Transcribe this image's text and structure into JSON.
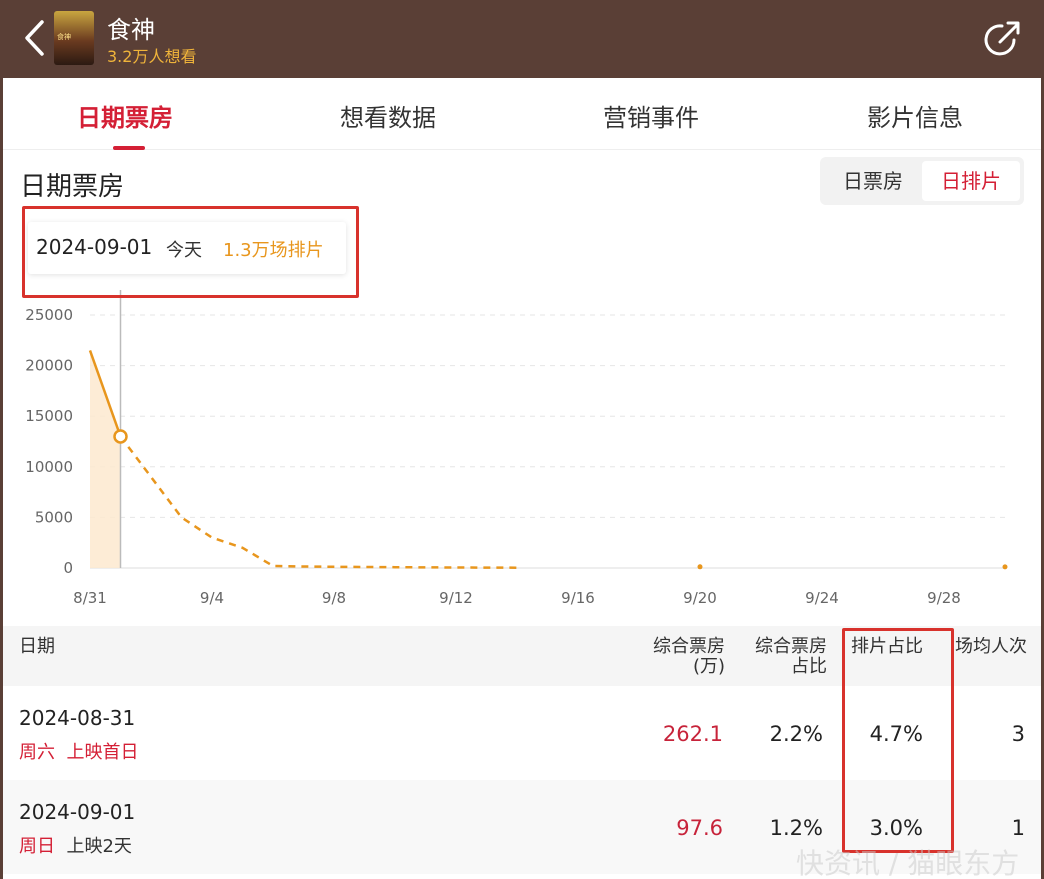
{
  "header": {
    "title": "食神",
    "want_count": "3.2万人想看",
    "poster_lettering": "食神"
  },
  "tabs": [
    {
      "label": "日期票房",
      "active": true
    },
    {
      "label": "想看数据",
      "active": false
    },
    {
      "label": "营销事件",
      "active": false
    },
    {
      "label": "影片信息",
      "active": false
    }
  ],
  "section": {
    "title": "日期票房",
    "toggle": [
      {
        "label": "日票房",
        "active": false
      },
      {
        "label": "日排片",
        "active": true
      }
    ]
  },
  "tooltip": {
    "date": "2024-09-01",
    "day": "今天",
    "value": "1.3万场排片"
  },
  "chart_data": {
    "type": "line",
    "x": [
      "8/31",
      "9/1",
      "9/2",
      "9/3",
      "9/4",
      "9/5",
      "9/6",
      "9/7",
      "9/8",
      "9/9",
      "9/10",
      "9/11",
      "9/12",
      "9/13",
      "9/14",
      "9/20",
      "9/30"
    ],
    "values": [
      21500,
      13000,
      9000,
      5000,
      3000,
      2000,
      200,
      150,
      120,
      100,
      80,
      60,
      50,
      40,
      30,
      20,
      10
    ],
    "tick_labels_x": [
      "8/31",
      "9/4",
      "9/8",
      "9/12",
      "9/16",
      "9/20",
      "9/24",
      "9/28"
    ],
    "tick_labels_y": [
      "0",
      "5000",
      "10000",
      "15000",
      "20000",
      "25000"
    ],
    "ylim": [
      0,
      25000
    ],
    "grid": true,
    "highlight_x": "9/1",
    "colors": {
      "line": "#e8961d",
      "area": "#fde9cf",
      "cursor": "#bbbbbb"
    }
  },
  "table": {
    "headers": {
      "date": "日期",
      "box_office": [
        "综合票房",
        "(万)"
      ],
      "box_share": [
        "综合票房",
        "占比"
      ],
      "screening_share": "排片占比",
      "avg_attendance": "场均人次"
    },
    "rows": [
      {
        "date": "2024-08-31",
        "weekday": "周六",
        "tag": "上映首日",
        "tag_color": "red",
        "box_office": "262.1",
        "box_share": "2.2%",
        "screening_share": "4.7%",
        "avg_attendance": "3"
      },
      {
        "date": "2024-09-01",
        "weekday": "周日",
        "tag": "上映2天",
        "tag_color": "gray",
        "box_office": "97.6",
        "box_share": "1.2%",
        "screening_share": "3.0%",
        "avg_attendance": "1"
      }
    ]
  },
  "watermark": "快资讯 / 猫眼东方"
}
